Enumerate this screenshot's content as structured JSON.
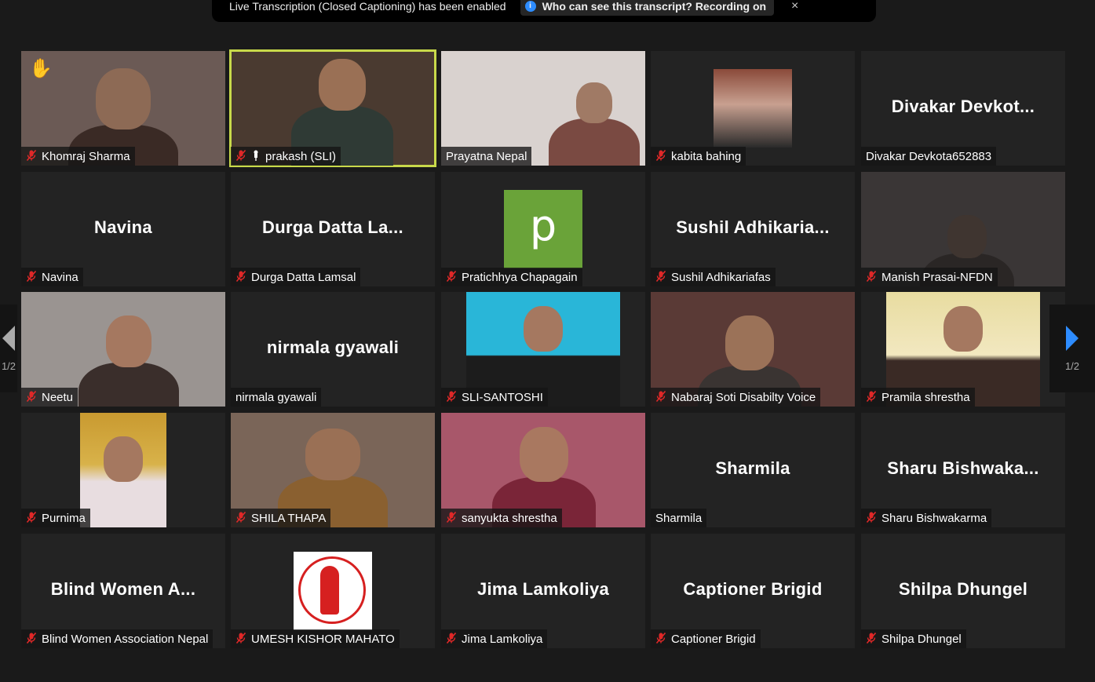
{
  "banner": {
    "message": "Live Transcription (Closed Captioning) has been enabled",
    "pill": "Who can see this transcript? Recording on",
    "close": "×"
  },
  "pagination": {
    "left": "1/2",
    "right": "1/2"
  },
  "icons": {
    "mic_muted": "mic-muted-icon",
    "raised_hand": "raised-hand-icon",
    "pin": "pin-icon"
  },
  "colors": {
    "accent": "#2d8cff",
    "active_speaker": "#c8d94a",
    "muted": "#e02828",
    "avatar_green": "#6aa339"
  },
  "tiles": [
    {
      "name": "Khomraj Sharma",
      "muted": true,
      "video": true,
      "hand": "✋"
    },
    {
      "name": "prakash (SLI)",
      "muted": true,
      "video": true,
      "active": true,
      "pin": true
    },
    {
      "name": "Prayatna Nepal",
      "muted": false,
      "video": true
    },
    {
      "name": "kabita bahing",
      "muted": true,
      "video": true
    },
    {
      "name": "Divakar Devkota652883",
      "display": "Divakar  Devkot...",
      "muted": false,
      "video": false
    },
    {
      "name": "Navina",
      "display": "Navina",
      "muted": true,
      "video": false
    },
    {
      "name": "Durga Datta Lamsal",
      "display": "Durga  Datta  La...",
      "muted": true,
      "video": false
    },
    {
      "name": "Pratichhya Chapagain",
      "muted": true,
      "video": false,
      "avatar": "p"
    },
    {
      "name": "Sushil Adhikariafas",
      "display": "Sushil  Adhikaria...",
      "muted": true,
      "video": false
    },
    {
      "name": "Manish Prasai-NFDN",
      "muted": true,
      "video": true
    },
    {
      "name": "Neetu",
      "muted": true,
      "video": true
    },
    {
      "name": "nirmala gyawali",
      "display": "nirmala gyawali",
      "muted": false,
      "video": false
    },
    {
      "name": "SLI-SANTOSHI",
      "muted": true,
      "video": true
    },
    {
      "name": "Nabaraj Soti Disabilty Voice",
      "muted": true,
      "video": true
    },
    {
      "name": "Pramila shrestha",
      "muted": true,
      "video": true
    },
    {
      "name": "Purnima",
      "muted": true,
      "video": true
    },
    {
      "name": "SHILA THAPA",
      "muted": true,
      "video": true
    },
    {
      "name": "sanyukta shrestha",
      "muted": true,
      "video": true
    },
    {
      "name": "Sharmila",
      "display": "Sharmila",
      "muted": false,
      "video": false
    },
    {
      "name": "Sharu Bishwakarma",
      "display": "Sharu  Bishwaka...",
      "muted": true,
      "video": false
    },
    {
      "name": "Blind Women Association Nepal",
      "display": "Blind  Women  A...",
      "muted": true,
      "video": false
    },
    {
      "name": "UMESH KISHOR MAHATO",
      "muted": true,
      "video": false,
      "logo": true
    },
    {
      "name": "Jima Lamkoliya",
      "display": "Jima Lamkoliya",
      "muted": true,
      "video": false
    },
    {
      "name": "Captioner Brigid",
      "display": "Captioner Brigid",
      "muted": true,
      "video": false
    },
    {
      "name": "Shilpa Dhungel",
      "display": "Shilpa Dhungel",
      "muted": true,
      "video": false
    }
  ]
}
